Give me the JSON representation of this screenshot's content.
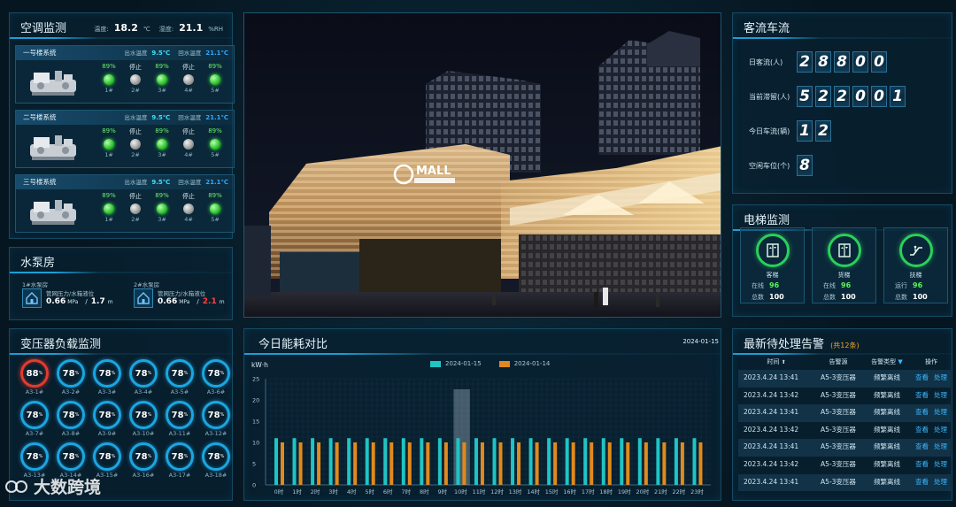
{
  "ac": {
    "title": "空调监测",
    "temp_label": "温度:",
    "temp_value": "18.2",
    "temp_unit": "℃",
    "hum_label": "湿度:",
    "hum_value": "21.1",
    "hum_unit": "%RH",
    "systems": [
      {
        "name": "一号楼系统",
        "out_label": "出水温度",
        "out_value": "9.5℃",
        "ret_label": "回水温度",
        "ret_value": "21.1℃",
        "units": [
          {
            "status": "89%",
            "on": true,
            "name": "1#"
          },
          {
            "status": "停止",
            "on": false,
            "name": "2#"
          },
          {
            "status": "89%",
            "on": true,
            "name": "3#"
          },
          {
            "status": "停止",
            "on": false,
            "name": "4#"
          },
          {
            "status": "89%",
            "on": true,
            "name": "5#"
          }
        ]
      },
      {
        "name": "二号楼系统",
        "out_label": "出水温度",
        "out_value": "9.5℃",
        "ret_label": "回水温度",
        "ret_value": "21.1℃",
        "units": [
          {
            "status": "89%",
            "on": true,
            "name": "1#"
          },
          {
            "status": "停止",
            "on": false,
            "name": "2#"
          },
          {
            "status": "89%",
            "on": true,
            "name": "3#"
          },
          {
            "status": "停止",
            "on": false,
            "name": "4#"
          },
          {
            "status": "89%",
            "on": true,
            "name": "5#"
          }
        ]
      },
      {
        "name": "三号楼系统",
        "out_label": "出水温度",
        "out_value": "9.5℃",
        "ret_label": "回水温度",
        "ret_value": "21.1℃",
        "units": [
          {
            "status": "89%",
            "on": true,
            "name": "1#"
          },
          {
            "status": "停止",
            "on": false,
            "name": "2#"
          },
          {
            "status": "89%",
            "on": true,
            "name": "3#"
          },
          {
            "status": "停止",
            "on": false,
            "name": "4#"
          },
          {
            "status": "89%",
            "on": true,
            "name": "5#"
          }
        ]
      }
    ]
  },
  "pump": {
    "title": "水泵房",
    "items": [
      {
        "name": "1#水泵房",
        "desc": "管网压力/水箱液位",
        "pressure": "0.66",
        "pressure_unit": "MPa",
        "sep": "/",
        "level": "1.7",
        "level_unit": "m",
        "alert": false
      },
      {
        "name": "2#水泵房",
        "desc": "管网压力/水箱液位",
        "pressure": "0.66",
        "pressure_unit": "MPa",
        "sep": "/",
        "level": "2.1",
        "level_unit": "m",
        "alert": true
      }
    ]
  },
  "transformer": {
    "title": "变压器负载监测",
    "percent_sign": "%",
    "items": [
      {
        "value": "88",
        "name": "A3-1#",
        "alert": true
      },
      {
        "value": "78",
        "name": "A3-2#"
      },
      {
        "value": "78",
        "name": "A3-3#"
      },
      {
        "value": "78",
        "name": "A3-4#"
      },
      {
        "value": "78",
        "name": "A3-5#"
      },
      {
        "value": "78",
        "name": "A3-6#"
      },
      {
        "value": "78",
        "name": "A3-7#"
      },
      {
        "value": "78",
        "name": "A3-8#"
      },
      {
        "value": "78",
        "name": "A3-9#"
      },
      {
        "value": "78",
        "name": "A3-10#"
      },
      {
        "value": "78",
        "name": "A3-11#"
      },
      {
        "value": "78",
        "name": "A3-12#"
      },
      {
        "value": "78",
        "name": "A3-13#"
      },
      {
        "value": "78",
        "name": "A3-14#"
      },
      {
        "value": "78",
        "name": "A3-15#"
      },
      {
        "value": "78",
        "name": "A3-16#"
      },
      {
        "value": "78",
        "name": "A3-17#"
      },
      {
        "value": "78",
        "name": "A3-18#"
      }
    ]
  },
  "photo": {
    "sign": "MALL"
  },
  "traffic": {
    "title": "客流车流",
    "rows": [
      {
        "label": "日客流(人)",
        "digits": [
          "2",
          "8",
          "8",
          "0",
          "0"
        ]
      },
      {
        "label": "当前滞留(人)",
        "digits": [
          "5",
          "2",
          "2",
          "0",
          "0",
          "1"
        ]
      },
      {
        "label": "今日车流(辆)",
        "digits": [
          "1",
          "2"
        ]
      },
      {
        "label": "空闲车位(个)",
        "digits": [
          "8"
        ]
      }
    ]
  },
  "elevator": {
    "title": "电梯监测",
    "items": [
      {
        "name": "客梯",
        "r1_label": "在线",
        "r1_value": "96",
        "r2_label": "总数",
        "r2_value": "100",
        "icon": "elevator-icon"
      },
      {
        "name": "货梯",
        "r1_label": "在线",
        "r1_value": "96",
        "r2_label": "总数",
        "r2_value": "100",
        "icon": "elevator-icon"
      },
      {
        "name": "扶梯",
        "r1_label": "运行",
        "r1_value": "96",
        "r2_label": "总数",
        "r2_value": "100",
        "icon": "escalator-icon"
      }
    ]
  },
  "energy": {
    "title": "今日能耗对比",
    "date": "2024-01-15"
  },
  "chart_data": {
    "type": "bar",
    "title": "今日能耗对比",
    "ylabel": "kW·h",
    "ylim": [
      0,
      25
    ],
    "yticks": [
      "25",
      "20",
      "15",
      "10",
      "5",
      "0"
    ],
    "categories": [
      "0时",
      "1时",
      "2时",
      "3时",
      "4时",
      "5时",
      "6时",
      "7时",
      "8时",
      "9时",
      "10时",
      "11时",
      "12时",
      "13时",
      "14时",
      "15时",
      "16时",
      "17时",
      "18时",
      "19时",
      "20时",
      "21时",
      "22时",
      "23时"
    ],
    "highlight_category": "10时",
    "series": [
      {
        "name": "2024-01-15",
        "color": "#1fc4c4",
        "values": [
          11,
          11,
          11,
          11,
          11,
          11,
          11,
          11,
          11,
          11,
          11,
          11,
          11,
          11,
          11,
          11,
          11,
          11,
          11,
          11,
          11,
          11,
          11,
          11
        ]
      },
      {
        "name": "2024-01-14",
        "color": "#e08a1e",
        "values": [
          10,
          10,
          10,
          10,
          10,
          10,
          10,
          10,
          10,
          10,
          10,
          10,
          10,
          10,
          10,
          10,
          10,
          10,
          10,
          10,
          10,
          10,
          10,
          10
        ]
      }
    ],
    "grid": true,
    "legend": "top-center"
  },
  "alarms": {
    "title": "最新待处理告警",
    "count": "(共12条)",
    "headers": {
      "time": "时间",
      "source": "告警源",
      "type": "告警类型",
      "op": "操作"
    },
    "view_label": "查看",
    "handle_label": "处理",
    "rows": [
      {
        "time": "2023.4.24 13:41",
        "source": "A5-3变压器",
        "type": "频繁离线"
      },
      {
        "time": "2023.4.24 13:42",
        "source": "A5-3变压器",
        "type": "频繁离线"
      },
      {
        "time": "2023.4.24 13:41",
        "source": "A5-3变压器",
        "type": "频繁离线"
      },
      {
        "time": "2023.4.24 13:42",
        "source": "A5-3变压器",
        "type": "频繁离线"
      },
      {
        "time": "2023.4.24 13:41",
        "source": "A5-3变压器",
        "type": "频繁离线"
      },
      {
        "time": "2023.4.24 13:42",
        "source": "A5-3变压器",
        "type": "频繁离线"
      },
      {
        "time": "2023.4.24 13:41",
        "source": "A5-3变压器",
        "type": "频繁离线"
      }
    ]
  },
  "watermark": {
    "text": "大数跨境"
  }
}
